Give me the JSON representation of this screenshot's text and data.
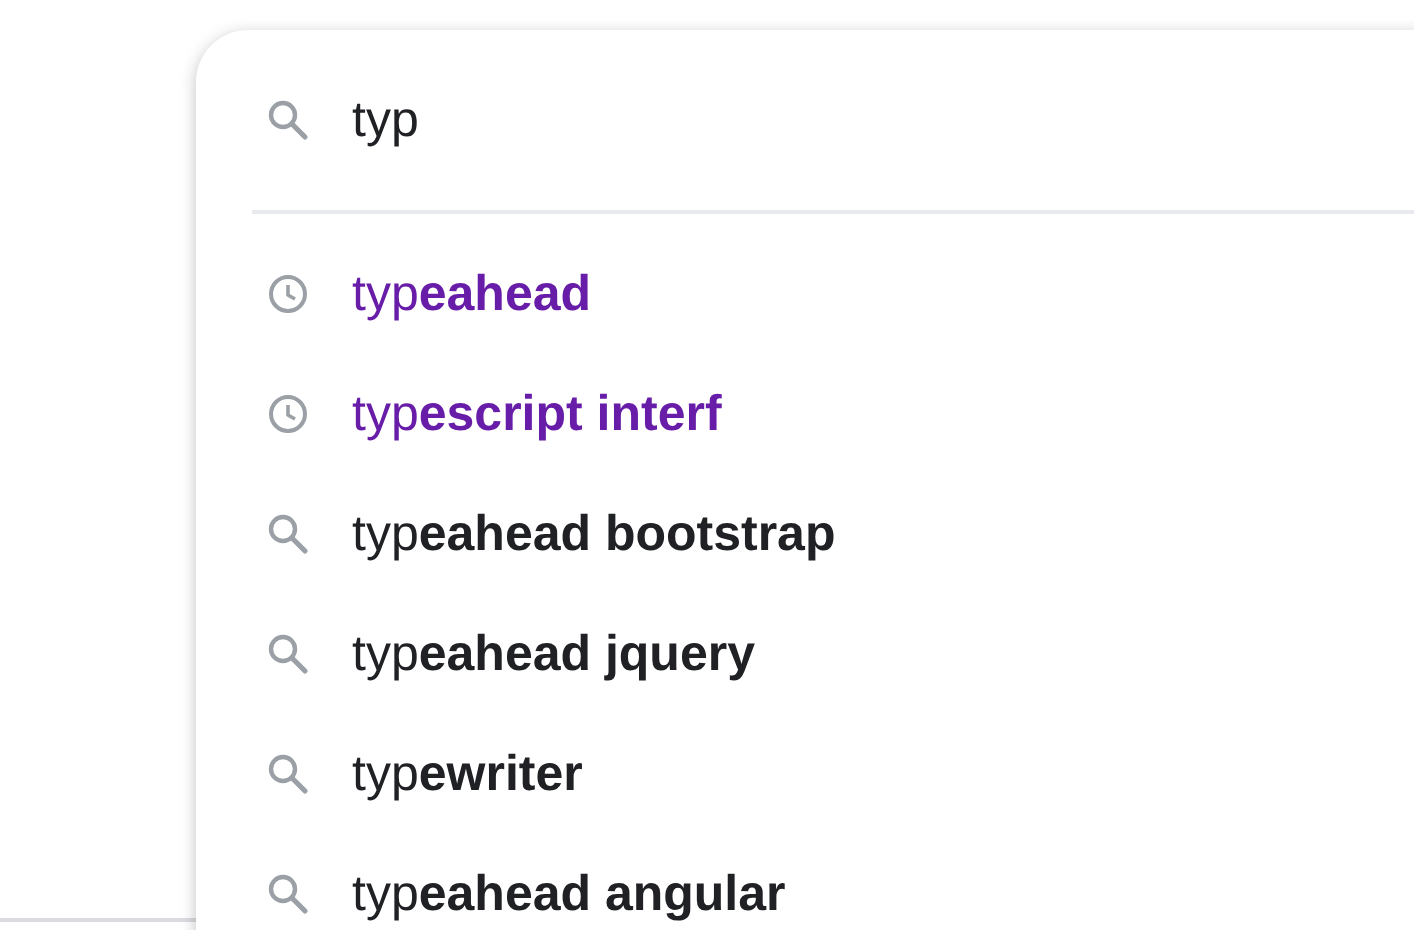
{
  "search": {
    "value": "typ"
  },
  "suggestions": [
    {
      "kind": "history",
      "text": "typ**eahead**"
    },
    {
      "kind": "history",
      "text": "typ**escript interf**"
    },
    {
      "kind": "search",
      "text": "typ**eahead bootstrap**"
    },
    {
      "kind": "search",
      "text": "typ**eahead jquery**"
    },
    {
      "kind": "search",
      "text": "typ**ewriter**"
    },
    {
      "kind": "search",
      "text": "typ**eahead angular**"
    }
  ]
}
